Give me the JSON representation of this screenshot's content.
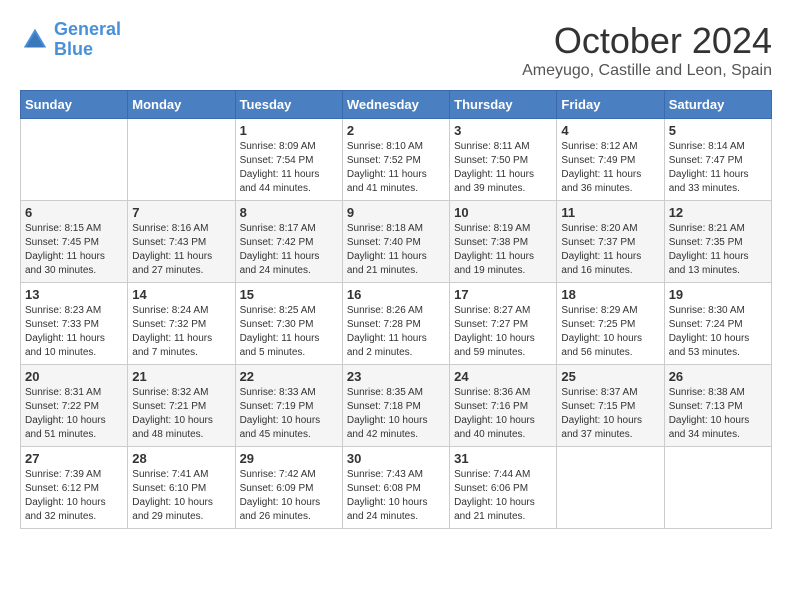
{
  "header": {
    "logo_line1": "General",
    "logo_line2": "Blue",
    "month": "October 2024",
    "location": "Ameyugo, Castille and Leon, Spain"
  },
  "days_of_week": [
    "Sunday",
    "Monday",
    "Tuesday",
    "Wednesday",
    "Thursday",
    "Friday",
    "Saturday"
  ],
  "weeks": [
    [
      {
        "day": "",
        "info": ""
      },
      {
        "day": "",
        "info": ""
      },
      {
        "day": "1",
        "info": "Sunrise: 8:09 AM\nSunset: 7:54 PM\nDaylight: 11 hours and 44 minutes."
      },
      {
        "day": "2",
        "info": "Sunrise: 8:10 AM\nSunset: 7:52 PM\nDaylight: 11 hours and 41 minutes."
      },
      {
        "day": "3",
        "info": "Sunrise: 8:11 AM\nSunset: 7:50 PM\nDaylight: 11 hours and 39 minutes."
      },
      {
        "day": "4",
        "info": "Sunrise: 8:12 AM\nSunset: 7:49 PM\nDaylight: 11 hours and 36 minutes."
      },
      {
        "day": "5",
        "info": "Sunrise: 8:14 AM\nSunset: 7:47 PM\nDaylight: 11 hours and 33 minutes."
      }
    ],
    [
      {
        "day": "6",
        "info": "Sunrise: 8:15 AM\nSunset: 7:45 PM\nDaylight: 11 hours and 30 minutes."
      },
      {
        "day": "7",
        "info": "Sunrise: 8:16 AM\nSunset: 7:43 PM\nDaylight: 11 hours and 27 minutes."
      },
      {
        "day": "8",
        "info": "Sunrise: 8:17 AM\nSunset: 7:42 PM\nDaylight: 11 hours and 24 minutes."
      },
      {
        "day": "9",
        "info": "Sunrise: 8:18 AM\nSunset: 7:40 PM\nDaylight: 11 hours and 21 minutes."
      },
      {
        "day": "10",
        "info": "Sunrise: 8:19 AM\nSunset: 7:38 PM\nDaylight: 11 hours and 19 minutes."
      },
      {
        "day": "11",
        "info": "Sunrise: 8:20 AM\nSunset: 7:37 PM\nDaylight: 11 hours and 16 minutes."
      },
      {
        "day": "12",
        "info": "Sunrise: 8:21 AM\nSunset: 7:35 PM\nDaylight: 11 hours and 13 minutes."
      }
    ],
    [
      {
        "day": "13",
        "info": "Sunrise: 8:23 AM\nSunset: 7:33 PM\nDaylight: 11 hours and 10 minutes."
      },
      {
        "day": "14",
        "info": "Sunrise: 8:24 AM\nSunset: 7:32 PM\nDaylight: 11 hours and 7 minutes."
      },
      {
        "day": "15",
        "info": "Sunrise: 8:25 AM\nSunset: 7:30 PM\nDaylight: 11 hours and 5 minutes."
      },
      {
        "day": "16",
        "info": "Sunrise: 8:26 AM\nSunset: 7:28 PM\nDaylight: 11 hours and 2 minutes."
      },
      {
        "day": "17",
        "info": "Sunrise: 8:27 AM\nSunset: 7:27 PM\nDaylight: 10 hours and 59 minutes."
      },
      {
        "day": "18",
        "info": "Sunrise: 8:29 AM\nSunset: 7:25 PM\nDaylight: 10 hours and 56 minutes."
      },
      {
        "day": "19",
        "info": "Sunrise: 8:30 AM\nSunset: 7:24 PM\nDaylight: 10 hours and 53 minutes."
      }
    ],
    [
      {
        "day": "20",
        "info": "Sunrise: 8:31 AM\nSunset: 7:22 PM\nDaylight: 10 hours and 51 minutes."
      },
      {
        "day": "21",
        "info": "Sunrise: 8:32 AM\nSunset: 7:21 PM\nDaylight: 10 hours and 48 minutes."
      },
      {
        "day": "22",
        "info": "Sunrise: 8:33 AM\nSunset: 7:19 PM\nDaylight: 10 hours and 45 minutes."
      },
      {
        "day": "23",
        "info": "Sunrise: 8:35 AM\nSunset: 7:18 PM\nDaylight: 10 hours and 42 minutes."
      },
      {
        "day": "24",
        "info": "Sunrise: 8:36 AM\nSunset: 7:16 PM\nDaylight: 10 hours and 40 minutes."
      },
      {
        "day": "25",
        "info": "Sunrise: 8:37 AM\nSunset: 7:15 PM\nDaylight: 10 hours and 37 minutes."
      },
      {
        "day": "26",
        "info": "Sunrise: 8:38 AM\nSunset: 7:13 PM\nDaylight: 10 hours and 34 minutes."
      }
    ],
    [
      {
        "day": "27",
        "info": "Sunrise: 7:39 AM\nSunset: 6:12 PM\nDaylight: 10 hours and 32 minutes."
      },
      {
        "day": "28",
        "info": "Sunrise: 7:41 AM\nSunset: 6:10 PM\nDaylight: 10 hours and 29 minutes."
      },
      {
        "day": "29",
        "info": "Sunrise: 7:42 AM\nSunset: 6:09 PM\nDaylight: 10 hours and 26 minutes."
      },
      {
        "day": "30",
        "info": "Sunrise: 7:43 AM\nSunset: 6:08 PM\nDaylight: 10 hours and 24 minutes."
      },
      {
        "day": "31",
        "info": "Sunrise: 7:44 AM\nSunset: 6:06 PM\nDaylight: 10 hours and 21 minutes."
      },
      {
        "day": "",
        "info": ""
      },
      {
        "day": "",
        "info": ""
      }
    ]
  ]
}
